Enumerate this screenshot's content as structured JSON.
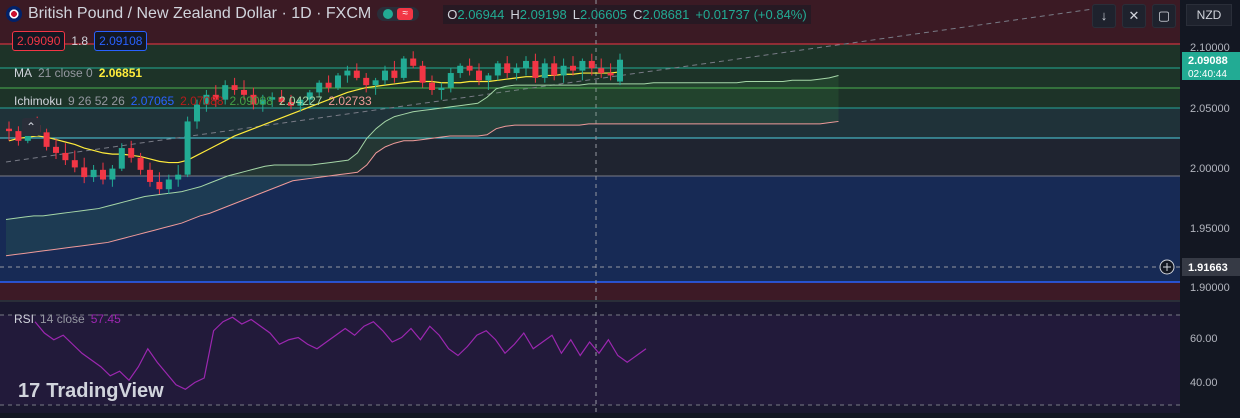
{
  "header": {
    "symbol": "British Pound / New Zealand Dollar · 1D · FXCM",
    "open_label": "O",
    "open": "2.06944",
    "high_label": "H",
    "high": "2.09198",
    "low_label": "L",
    "low": "2.06605",
    "close_label": "C",
    "close": "2.08681",
    "change": "+0.01737 (+0.84%)",
    "bid": "2.09090",
    "spread": "1.8",
    "ask": "2.09108",
    "currency": "NZD",
    "wave_icon": "≈"
  },
  "indicators": {
    "ma": {
      "name": "MA",
      "params": "21 close 0",
      "value": "2.06851",
      "color": "#ffeb3b"
    },
    "ichimoku": {
      "name": "Ichimoku",
      "params": "9 26 52 26",
      "v1": "2.07065",
      "v2": "2.07088",
      "v3": "2.09088",
      "v4": "2.04227",
      "v5": "2.02733"
    },
    "rsi": {
      "name": "RSI",
      "params": "14 close",
      "value": "57.45",
      "color": "#9c27b0"
    }
  },
  "price_axis": {
    "ticks": [
      "2.10000",
      "2.05000",
      "2.00000",
      "1.95000",
      "1.90000"
    ],
    "current_price": "2.09088",
    "countdown": "02:40:44",
    "crosshair_price": "1.91663"
  },
  "rsi_axis": {
    "ticks": [
      "60.00",
      "40.00"
    ]
  },
  "logo": {
    "text": "TradingView",
    "mark": "17"
  },
  "chart_data": {
    "type": "candlestick",
    "title": "British Pound / New Zealand Dollar · 1D · FXCM",
    "ylim": [
      1.88,
      2.115
    ],
    "rsi_ylim": [
      30,
      80
    ],
    "candles": [
      [
        2.03,
        2.036,
        2.02,
        2.028
      ],
      [
        2.028,
        2.032,
        2.016,
        2.02
      ],
      [
        2.02,
        2.035,
        2.018,
        2.033
      ],
      [
        2.033,
        2.04,
        2.025,
        2.027
      ],
      [
        2.027,
        2.03,
        2.012,
        2.015
      ],
      [
        2.015,
        2.022,
        2.005,
        2.01
      ],
      [
        2.01,
        2.018,
        2.0,
        2.004
      ],
      [
        2.004,
        2.012,
        1.994,
        1.998
      ],
      [
        1.998,
        2.006,
        1.985,
        1.99
      ],
      [
        1.99,
        2.0,
        1.986,
        1.996
      ],
      [
        1.996,
        2.002,
        1.984,
        1.988
      ],
      [
        1.988,
        2.0,
        1.982,
        1.997
      ],
      [
        1.997,
        2.018,
        1.995,
        2.014
      ],
      [
        2.014,
        2.02,
        2.002,
        2.006
      ],
      [
        2.006,
        2.01,
        1.992,
        1.996
      ],
      [
        1.996,
        2.002,
        1.982,
        1.986
      ],
      [
        1.986,
        1.994,
        1.976,
        1.98
      ],
      [
        1.98,
        1.992,
        1.976,
        1.988
      ],
      [
        1.988,
        2.0,
        1.982,
        1.992
      ],
      [
        1.992,
        2.04,
        1.99,
        2.036
      ],
      [
        2.036,
        2.054,
        2.03,
        2.05
      ],
      [
        2.05,
        2.062,
        2.044,
        2.058
      ],
      [
        2.058,
        2.066,
        2.048,
        2.054
      ],
      [
        2.054,
        2.07,
        2.05,
        2.066
      ],
      [
        2.066,
        2.072,
        2.058,
        2.062
      ],
      [
        2.062,
        2.07,
        2.054,
        2.058
      ],
      [
        2.058,
        2.064,
        2.046,
        2.05
      ],
      [
        2.05,
        2.058,
        2.044,
        2.054
      ],
      [
        2.054,
        2.06,
        2.048,
        2.056
      ],
      [
        2.056,
        2.062,
        2.05,
        2.052
      ],
      [
        2.052,
        2.058,
        2.046,
        2.049
      ],
      [
        2.049,
        2.056,
        2.044,
        2.054
      ],
      [
        2.054,
        2.062,
        2.05,
        2.06
      ],
      [
        2.06,
        2.07,
        2.056,
        2.068
      ],
      [
        2.068,
        2.074,
        2.06,
        2.064
      ],
      [
        2.064,
        2.076,
        2.062,
        2.074
      ],
      [
        2.074,
        2.082,
        2.068,
        2.078
      ],
      [
        2.078,
        2.084,
        2.07,
        2.072
      ],
      [
        2.072,
        2.076,
        2.06,
        2.066
      ],
      [
        2.066,
        2.072,
        2.058,
        2.07
      ],
      [
        2.07,
        2.082,
        2.066,
        2.078
      ],
      [
        2.078,
        2.086,
        2.068,
        2.072
      ],
      [
        2.072,
        2.09,
        2.07,
        2.088
      ],
      [
        2.088,
        2.094,
        2.08,
        2.082
      ],
      [
        2.082,
        2.086,
        2.064,
        2.068
      ],
      [
        2.068,
        2.074,
        2.058,
        2.062
      ],
      [
        2.062,
        2.068,
        2.054,
        2.064
      ],
      [
        2.064,
        2.08,
        2.06,
        2.076
      ],
      [
        2.076,
        2.084,
        2.072,
        2.082
      ],
      [
        2.082,
        2.088,
        2.074,
        2.078
      ],
      [
        2.078,
        2.084,
        2.066,
        2.07
      ],
      [
        2.07,
        2.076,
        2.062,
        2.074
      ],
      [
        2.074,
        2.086,
        2.07,
        2.084
      ],
      [
        2.084,
        2.09,
        2.072,
        2.076
      ],
      [
        2.076,
        2.084,
        2.07,
        2.08
      ],
      [
        2.08,
        2.09,
        2.074,
        2.086
      ],
      [
        2.086,
        2.092,
        2.068,
        2.072
      ],
      [
        2.072,
        2.088,
        2.068,
        2.084
      ],
      [
        2.084,
        2.09,
        2.07,
        2.074
      ],
      [
        2.074,
        2.088,
        2.068,
        2.082
      ],
      [
        2.082,
        2.09,
        2.074,
        2.078
      ],
      [
        2.078,
        2.088,
        2.07,
        2.086
      ],
      [
        2.086,
        2.092,
        2.074,
        2.08
      ],
      [
        2.08,
        2.088,
        2.072,
        2.076
      ],
      [
        2.076,
        2.084,
        2.07,
        2.074
      ],
      [
        2.069,
        2.092,
        2.066,
        2.087
      ]
    ],
    "ma21": [
      2.02,
      2.022,
      2.023,
      2.024,
      2.023,
      2.021,
      2.019,
      2.017,
      2.014,
      2.012,
      2.01,
      2.009,
      2.009,
      2.008,
      2.007,
      2.005,
      2.003,
      2.002,
      2.002,
      2.004,
      2.008,
      2.012,
      2.016,
      2.02,
      2.024,
      2.027,
      2.03,
      2.033,
      2.036,
      2.039,
      2.042,
      2.045,
      2.048,
      2.051,
      2.054,
      2.057,
      2.06,
      2.062,
      2.064,
      2.065,
      2.066,
      2.067,
      2.068,
      2.069,
      2.069,
      2.069,
      2.068,
      2.068,
      2.068,
      2.069,
      2.069,
      2.069,
      2.07,
      2.071,
      2.072,
      2.073,
      2.073,
      2.074,
      2.074,
      2.075,
      2.075,
      2.076,
      2.076,
      2.076,
      2.076,
      2.077
    ],
    "ichimoku_leading_a": [
      1.955,
      1.956,
      1.957,
      1.958,
      1.958,
      1.959,
      1.96,
      1.961,
      1.962,
      1.963,
      1.964,
      1.966,
      1.968,
      1.97,
      1.972,
      1.974,
      1.975,
      1.976,
      1.977,
      1.978,
      1.98,
      1.982,
      1.985,
      1.988,
      1.991,
      1.993,
      1.995,
      1.997,
      1.999,
      2.0,
      2.0,
      2.0,
      2.0,
      2.0,
      2.001,
      2.002,
      2.003,
      2.004,
      2.01,
      2.022,
      2.03,
      2.036,
      2.04,
      2.042,
      2.044,
      2.045,
      2.046,
      2.047,
      2.048,
      2.049,
      2.05,
      2.051,
      2.056,
      2.063,
      2.065,
      2.066,
      2.066,
      2.066,
      2.066,
      2.066,
      2.066,
      2.066,
      2.066,
      2.067,
      2.067,
      2.067,
      2.067,
      2.067,
      2.067,
      2.067,
      2.068,
      2.068,
      2.068,
      2.068,
      2.068,
      2.068,
      2.068,
      2.068,
      2.068,
      2.068,
      2.069,
      2.069,
      2.069,
      2.069,
      2.069,
      2.07,
      2.07,
      2.07,
      2.071,
      2.072,
      2.074
    ],
    "ichimoku_leading_b": [
      1.925,
      1.926,
      1.927,
      1.928,
      1.929,
      1.93,
      1.931,
      1.932,
      1.933,
      1.934,
      1.935,
      1.936,
      1.938,
      1.94,
      1.942,
      1.944,
      1.946,
      1.948,
      1.95,
      1.952,
      1.955,
      1.958,
      1.96,
      1.963,
      1.966,
      1.969,
      1.972,
      1.975,
      1.978,
      1.981,
      1.984,
      1.987,
      1.988,
      1.989,
      1.99,
      1.991,
      1.992,
      1.993,
      1.994,
      2.0,
      2.01,
      2.015,
      2.018,
      2.02,
      2.02,
      2.021,
      2.022,
      2.023,
      2.024,
      2.024,
      2.024,
      2.024,
      2.025,
      2.03,
      2.032,
      2.033,
      2.033,
      2.033,
      2.033,
      2.033,
      2.033,
      2.033,
      2.033,
      2.034,
      2.034,
      2.034,
      2.034,
      2.034,
      2.034,
      2.034,
      2.034,
      2.034,
      2.034,
      2.034,
      2.034,
      2.034,
      2.034,
      2.034,
      2.034,
      2.034,
      2.034,
      2.034,
      2.034,
      2.034,
      2.034,
      2.034,
      2.034,
      2.034,
      2.034,
      2.035,
      2.036
    ],
    "rsi": [
      72,
      67,
      64,
      66,
      62,
      58,
      55,
      52,
      48,
      50,
      46,
      52,
      60,
      54,
      49,
      44,
      42,
      45,
      47,
      68,
      72,
      74,
      71,
      73,
      70,
      67,
      62,
      64,
      65,
      62,
      60,
      63,
      66,
      69,
      66,
      70,
      72,
      68,
      63,
      65,
      69,
      64,
      70,
      66,
      60,
      57,
      61,
      66,
      68,
      64,
      58,
      62,
      67,
      60,
      63,
      66,
      58,
      64,
      57,
      63,
      58,
      64,
      57,
      54,
      57,
      60
    ]
  }
}
